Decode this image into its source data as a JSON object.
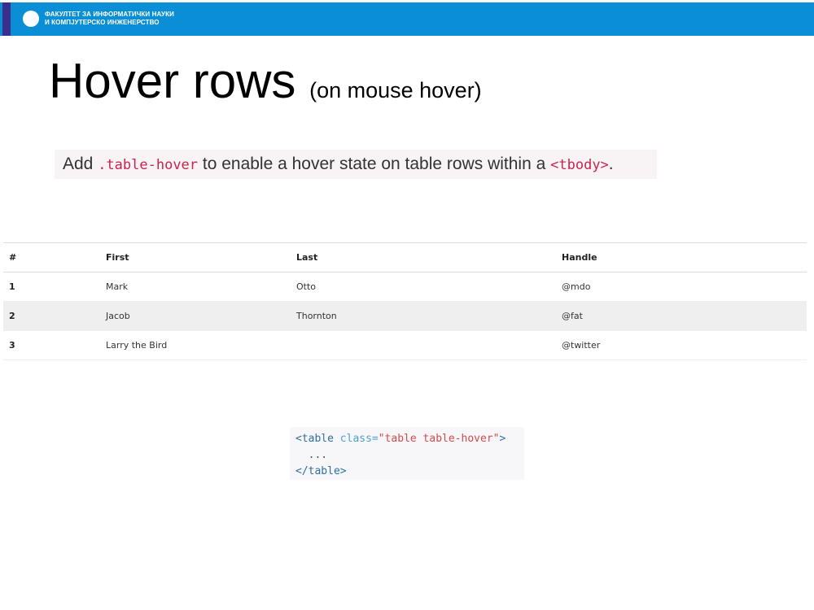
{
  "header": {
    "line1": "ФАКУЛТЕТ ЗА ИНФОРМАТИЧКИ НАУКИ",
    "line2": "И КОМПЈУТЕРСКО ИНЖЕНЕРСТВО",
    "bar_color": "#0a8fd6",
    "accent_color": "#3a2d8c"
  },
  "title": {
    "main": "Hover rows",
    "sub": "(on mouse hover)"
  },
  "description": {
    "part1": "Add ",
    "code1": ".table-hover",
    "part2": " to enable a hover state on table rows within a ",
    "code2": "<tbody>",
    "part3": "."
  },
  "table": {
    "headers": [
      "#",
      "First",
      "Last",
      "Handle"
    ],
    "rows": [
      [
        "1",
        "Mark",
        "Otto",
        "@mdo"
      ],
      [
        "2",
        "Jacob",
        "Thornton",
        "@fat"
      ],
      [
        "3",
        "Larry the Bird",
        "",
        "@twitter"
      ]
    ],
    "hovered_row": 2
  },
  "code_block": {
    "open_tag": "<table",
    "attr_name": " class=",
    "attr_value": "\"table table-hover\"",
    "open_close": ">",
    "dots": "  ...",
    "close_tag": "</table>"
  }
}
